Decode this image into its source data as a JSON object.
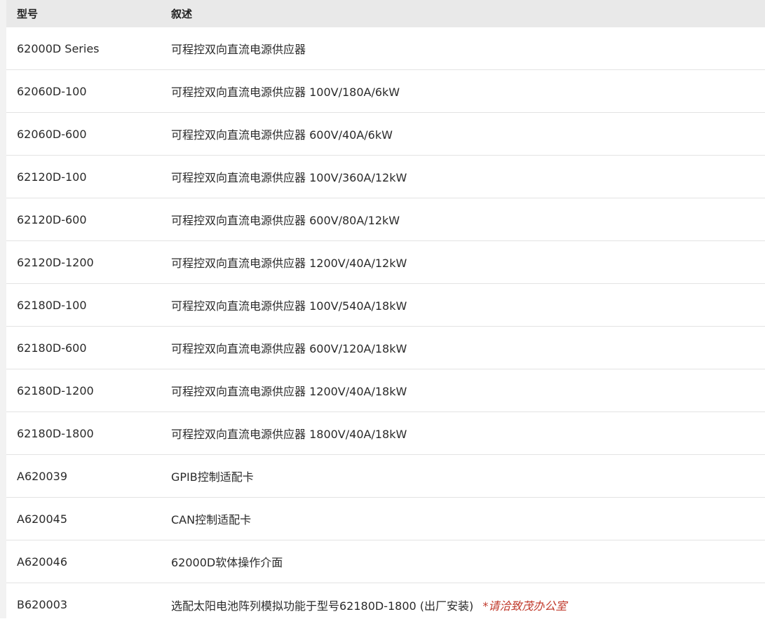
{
  "table": {
    "headers": {
      "model": "型号",
      "description": "叙述"
    },
    "rows": [
      {
        "model": "62000D Series",
        "description": "可程控双向直流电源供应器",
        "note": ""
      },
      {
        "model": "62060D-100",
        "description": "可程控双向直流电源供应器 100V/180A/6kW",
        "note": ""
      },
      {
        "model": "62060D-600",
        "description": "可程控双向直流电源供应器 600V/40A/6kW",
        "note": ""
      },
      {
        "model": "62120D-100",
        "description": "可程控双向直流电源供应器 100V/360A/12kW",
        "note": ""
      },
      {
        "model": "62120D-600",
        "description": "可程控双向直流电源供应器 600V/80A/12kW",
        "note": ""
      },
      {
        "model": "62120D-1200",
        "description": "可程控双向直流电源供应器 1200V/40A/12kW",
        "note": ""
      },
      {
        "model": "62180D-100",
        "description": "可程控双向直流电源供应器 100V/540A/18kW",
        "note": ""
      },
      {
        "model": "62180D-600",
        "description": "可程控双向直流电源供应器 600V/120A/18kW",
        "note": ""
      },
      {
        "model": "62180D-1200",
        "description": "可程控双向直流电源供应器 1200V/40A/18kW",
        "note": ""
      },
      {
        "model": "62180D-1800",
        "description": "可程控双向直流电源供应器 1800V/40A/18kW",
        "note": ""
      },
      {
        "model": "A620039",
        "description": "GPIB控制适配卡",
        "note": ""
      },
      {
        "model": "A620045",
        "description": "CAN控制适配卡",
        "note": ""
      },
      {
        "model": "A620046",
        "description": "62000D软体操作介面",
        "note": ""
      },
      {
        "model": "B620003",
        "description": "选配太阳电池阵列模拟功能于型号62180D-1800 (出厂安装)",
        "note": "*请洽致茂办公室"
      }
    ]
  },
  "colors": {
    "header_background": "#e9e9e9",
    "row_divider": "#e3e3e3",
    "note_text": "#c0392b"
  }
}
